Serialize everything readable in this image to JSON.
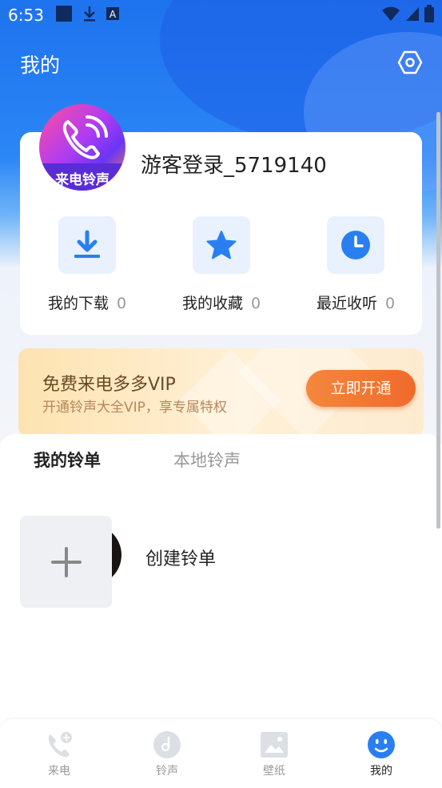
{
  "status_bar": {
    "time": "6:53",
    "icons": [
      "square-notification-icon",
      "download-icon",
      "a-notification-icon",
      "wifi-icon",
      "signal-icon",
      "battery-icon"
    ]
  },
  "header": {
    "title": "我的",
    "settings_icon": "settings-hexagon-icon"
  },
  "profile": {
    "avatar_text": "来电铃声",
    "username": "游客登录_5719140"
  },
  "quick_actions": [
    {
      "label": "我的下载",
      "count": "0",
      "icon": "download-icon"
    },
    {
      "label": "我的收藏",
      "count": "0",
      "icon": "star-icon"
    },
    {
      "label": "最近收听",
      "count": "0",
      "icon": "clock-icon"
    }
  ],
  "vip_banner": {
    "title": "免费来电多多VIP",
    "subtitle": "开通铃声大全VIP，享专属特权",
    "button": "立即开通"
  },
  "tabs": [
    {
      "label": "我的铃单",
      "active": true
    },
    {
      "label": "本地铃声",
      "active": false
    }
  ],
  "create_playlist": {
    "label": "创建铃单",
    "icon": "plus-icon"
  },
  "bottom_nav": [
    {
      "label": "来电",
      "icon": "phone-icon",
      "active": false
    },
    {
      "label": "铃声",
      "icon": "music-disc-icon",
      "active": false
    },
    {
      "label": "壁纸",
      "icon": "image-icon",
      "active": false
    },
    {
      "label": "我的",
      "icon": "face-icon",
      "active": true
    }
  ],
  "colors": {
    "primary_blue": "#1e73ee",
    "icon_blue": "#2a7ff0",
    "vip_button": "#ef6a2c",
    "vip_text": "#6b4a25"
  }
}
